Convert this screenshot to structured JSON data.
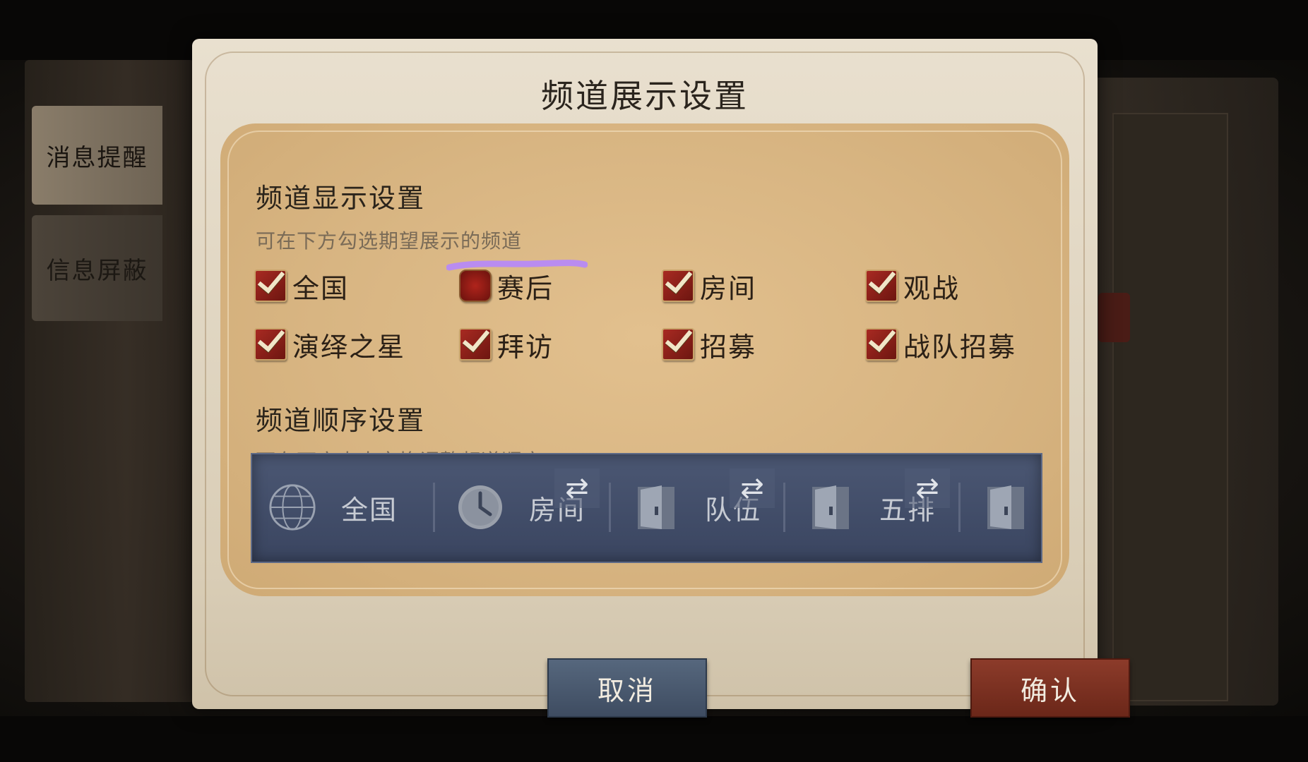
{
  "sidebar": {
    "tabs": [
      {
        "label": "消息提醒"
      },
      {
        "label": "信息屏蔽"
      }
    ]
  },
  "dialog": {
    "title": "频道展示设置"
  },
  "display_settings": {
    "title": "频道显示设置",
    "description": "可在下方勾选期望展示的频道",
    "channels": [
      {
        "label": "全国",
        "checked": true
      },
      {
        "label": "赛后",
        "checked": false
      },
      {
        "label": "房间",
        "checked": true
      },
      {
        "label": "观战",
        "checked": true
      },
      {
        "label": "演绎之星",
        "checked": true
      },
      {
        "label": "拜访",
        "checked": true
      },
      {
        "label": "招募",
        "checked": true
      },
      {
        "label": "战队招募",
        "checked": true
      }
    ]
  },
  "order_settings": {
    "title": "频道顺序设置",
    "description": "可在下方点击交换调整频道顺序",
    "slots": [
      {
        "label": "全国",
        "icon": "globe-icon"
      },
      {
        "label": "房间",
        "icon": "clock-icon"
      },
      {
        "label": "队伍",
        "icon": "door-icon"
      },
      {
        "label": "五排",
        "icon": "door-icon"
      },
      {
        "label": "",
        "icon": "door-icon"
      }
    ]
  },
  "buttons": {
    "cancel": "取消",
    "confirm": "确认"
  },
  "colors": {
    "accent_red": "#8c3b2a",
    "slate": "#3e4c61",
    "panel": "#d8b582"
  }
}
